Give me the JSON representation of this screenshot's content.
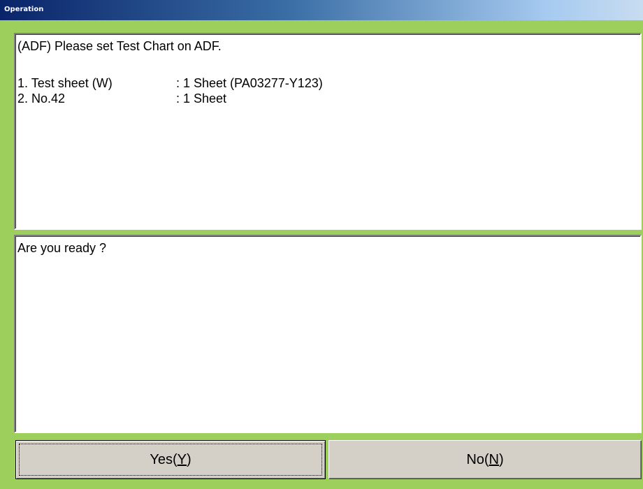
{
  "window": {
    "title": "Operation"
  },
  "instructions": {
    "heading": "(ADF) Please set Test Chart on ADF.",
    "items": [
      {
        "name": "1. Test sheet (W)",
        "value": ": 1 Sheet (PA03277-Y123)"
      },
      {
        "name": "2. No.42",
        "value": ": 1 Sheet"
      }
    ]
  },
  "prompt": {
    "text": "Are you ready ?"
  },
  "buttons": {
    "yes": {
      "prefix": "Yes(",
      "mnemonic": "Y",
      "suffix": ")"
    },
    "no": {
      "prefix": "No(",
      "mnemonic": "N",
      "suffix": ")"
    }
  },
  "colors": {
    "frame": "#9ccf5c",
    "titlebar_start": "#0a246a",
    "titlebar_end": "#c8dcf0",
    "button_face": "#d4d0c8"
  }
}
